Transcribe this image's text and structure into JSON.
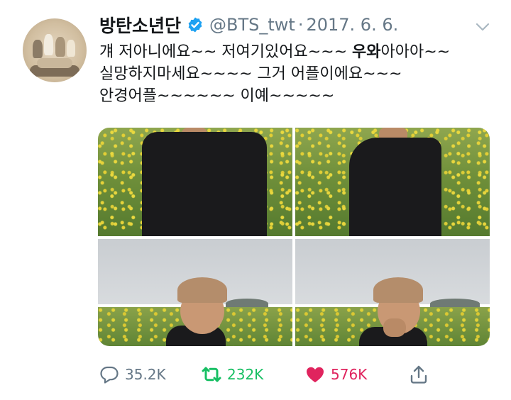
{
  "tweet": {
    "author_name": "방탄소년단",
    "handle": "@BTS_twt",
    "separator": "·",
    "date": "2017. 6. 6.",
    "text_lines": [
      {
        "before": "걔 저아니에요~~ 저여기있어요~~~ ",
        "bold": "우와",
        "after": "아아아~~"
      },
      {
        "before": "실망하지마세요~~~~ 그거 어플이에요~~~",
        "bold": "",
        "after": ""
      },
      {
        "before": "안경어플~~~~~~ 이예~~~~~",
        "bold": "",
        "after": ""
      }
    ]
  },
  "actions": {
    "reply_count": "35.2K",
    "retweet_count": "232K",
    "like_count": "576K"
  },
  "colors": {
    "verified": "#1da1f2",
    "retweet": "#17bf63",
    "like": "#e0245e",
    "muted": "#657786"
  },
  "icons": [
    "verified-badge-icon",
    "chevron-down-icon",
    "reply-icon",
    "retweet-icon",
    "heart-icon",
    "share-icon"
  ]
}
